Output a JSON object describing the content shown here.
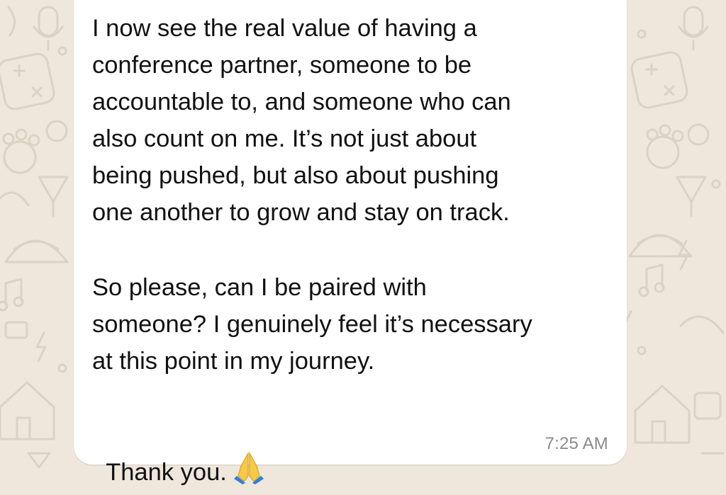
{
  "chat": {
    "background_color": "#efe7dc",
    "bubble_color": "#ffffff",
    "message": {
      "paragraph_1": "I now see the real value of having a\nconference partner, someone to be\naccountable to, and someone who can\nalso count on me. It’s not just about\nbeing pushed, but also about pushing\none another to grow and stay on track.",
      "paragraph_2": "So please, can I be paired with\nsomeone? I genuinely feel it’s necessary\nat this point in my journey.",
      "paragraph_3": "Thank you.",
      "emoji": "folded-hands-emoji",
      "timestamp": "7:25 AM"
    },
    "wallpaper_icons": [
      "microphone-icon",
      "calculator-icon",
      "bear-paw-icon",
      "cocktail-icon",
      "taco-icon",
      "lightning-icon",
      "house-icon",
      "moon-icon",
      "music-note-icon"
    ]
  }
}
